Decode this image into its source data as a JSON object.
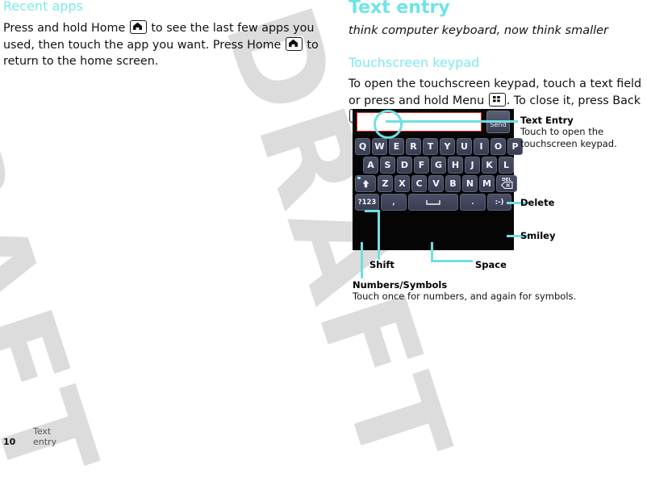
{
  "accent_color": "#7fe9ea",
  "callout_color": "#6fe0e3",
  "left_column": {
    "section_heading": "Recent apps",
    "body_part1": "Press and hold Home ",
    "body_part2": " to see the last few apps you used, then touch the app you want. Press Home ",
    "body_part3": " to return to the home screen."
  },
  "right_column": {
    "chapter_title": "Text entry",
    "chapter_subtitle": "think computer keyboard, now think smaller",
    "section_heading": "Touchscreen keypad",
    "body_part1": "To open the touchscreen keypad, touch a text field or press and hold Menu ",
    "body_part2": ". To close it, press Back ",
    "body_part3": "."
  },
  "keyboard": {
    "send_label": "Send",
    "row1": [
      "Q",
      "W",
      "E",
      "R",
      "T",
      "Y",
      "U",
      "I",
      "O",
      "P"
    ],
    "row2": [
      "A",
      "S",
      "D",
      "F",
      "G",
      "H",
      "J",
      "K",
      "L"
    ],
    "row3": [
      "Z",
      "X",
      "C",
      "V",
      "B",
      "N",
      "M"
    ],
    "shift_label": "⬆",
    "delete_label": "DEL",
    "numbers_label": "?123",
    "comma_label": ",",
    "space_label": "",
    "period_label": ".",
    "smiley_label": ":-)"
  },
  "callouts": {
    "text_entry": {
      "title": "Text Entry",
      "description": "Touch to open the\ntouchscreen keypad."
    },
    "delete": {
      "title": "Delete"
    },
    "smiley": {
      "title": "Smiley"
    },
    "shift": {
      "title": "Shift"
    },
    "space": {
      "title": "Space"
    },
    "numbers_symbols": {
      "title": "Numbers/Symbols",
      "description": "Touch once for numbers, and again for symbols."
    }
  },
  "watermark": {
    "text": "DRAFT"
  },
  "footer": {
    "page_number": "10",
    "page_title": "Text entry"
  }
}
